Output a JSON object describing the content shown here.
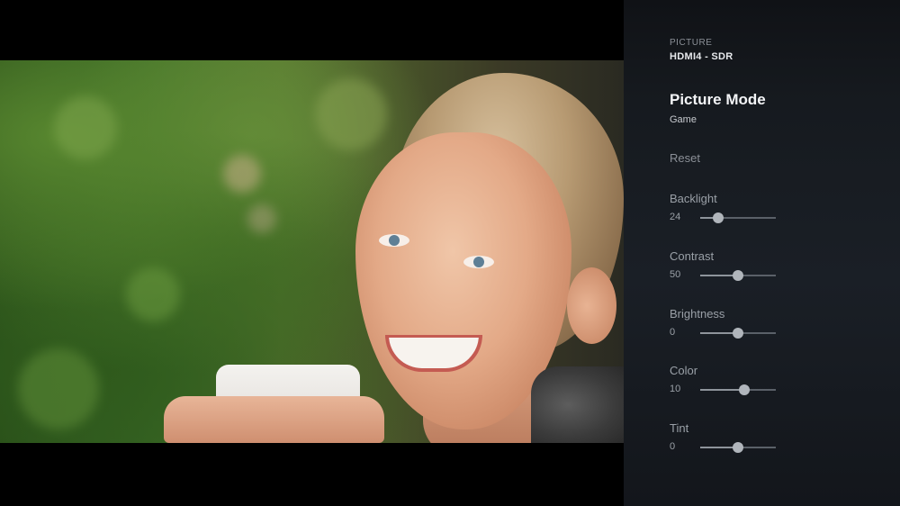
{
  "panel": {
    "section_label": "PICTURE",
    "source": "HDMI4 - SDR",
    "picture_mode": {
      "title": "Picture Mode",
      "value": "Game"
    },
    "reset_label": "Reset",
    "settings": [
      {
        "label": "Backlight",
        "value": "24",
        "level": 0.24
      },
      {
        "label": "Contrast",
        "value": "50",
        "level": 0.5
      },
      {
        "label": "Brightness",
        "value": "0",
        "level": 0.5
      },
      {
        "label": "Color",
        "value": "10",
        "level": 0.58
      },
      {
        "label": "Tint",
        "value": "0",
        "level": 0.5
      }
    ]
  },
  "colors": {
    "panel_bg": "#161a1f",
    "text_primary": "#f3f4f6",
    "text_secondary": "#9aa0a7",
    "slider_track": "#5a6068",
    "slider_thumb": "#b0b5bb"
  }
}
